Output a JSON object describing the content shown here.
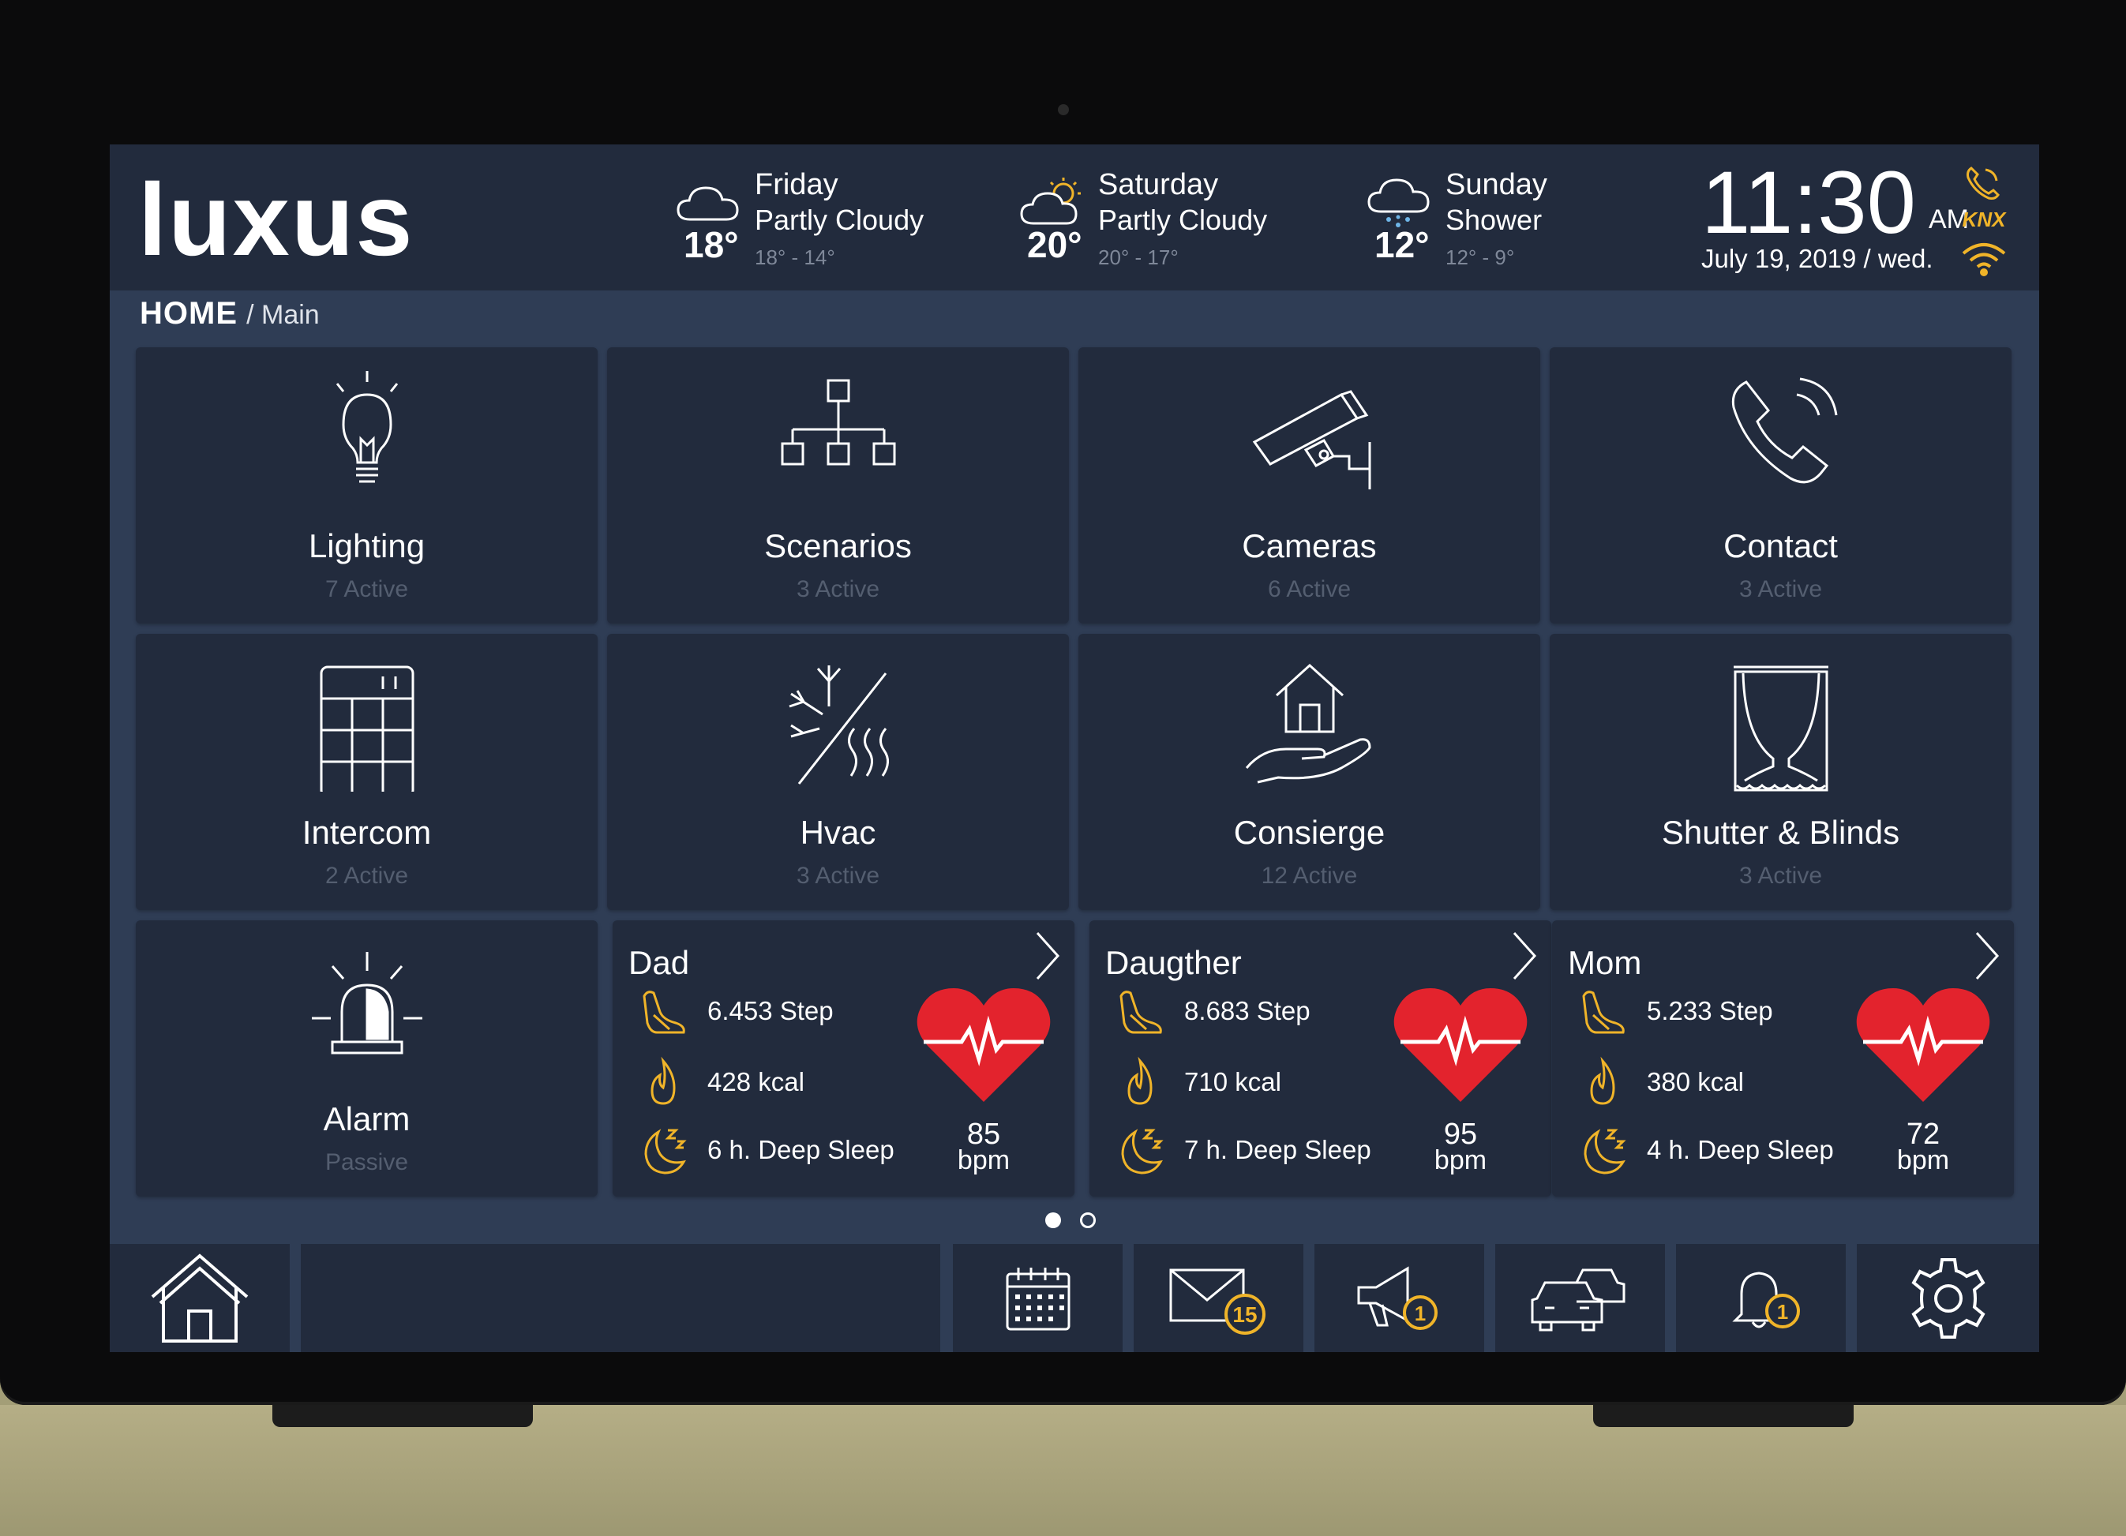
{
  "logo": "luxus",
  "weather": [
    {
      "day": "Friday",
      "condition": "Partly Cloudy",
      "temp": "18°",
      "range": "18° - 14°",
      "icon": "cloud-icon"
    },
    {
      "day": "Saturday",
      "condition": "Partly Cloudy",
      "temp": "20°",
      "range": "20° - 17°",
      "icon": "partly-cloudy-icon"
    },
    {
      "day": "Sunday",
      "condition": "Shower",
      "temp": "12°",
      "range": "12° - 9°",
      "icon": "shower-icon"
    }
  ],
  "clock": {
    "time": "11:30",
    "ampm": "AM",
    "date": "July 19, 2019 / wed."
  },
  "status": {
    "knx": "KNX"
  },
  "breadcrumb": {
    "home": "HOME",
    "sub": "/ Main"
  },
  "tiles": [
    {
      "name": "Lighting",
      "status": "7 Active",
      "icon": "lightbulb-icon"
    },
    {
      "name": "Scenarios",
      "status": "3 Active",
      "icon": "hierarchy-icon"
    },
    {
      "name": "Cameras",
      "status": "6 Active",
      "icon": "security-camera-icon"
    },
    {
      "name": "Contact",
      "status": "3 Active",
      "icon": "phone-icon"
    },
    {
      "name": "Intercom",
      "status": "2 Active",
      "icon": "intercom-icon"
    },
    {
      "name": "Hvac",
      "status": "3 Active",
      "icon": "hvac-icon"
    },
    {
      "name": "Consierge",
      "status": "12 Active",
      "icon": "house-hand-icon"
    },
    {
      "name": "Shutter & Blinds",
      "status": "3 Active",
      "icon": "curtains-icon"
    },
    {
      "name": "Alarm",
      "status": "Passive",
      "icon": "alarm-siren-icon"
    }
  ],
  "health": [
    {
      "name": "Dad",
      "steps": "6.453 Step",
      "kcal": "428 kcal",
      "sleep": "6 h. Deep Sleep",
      "bpm": "85",
      "bpm_unit": "bpm"
    },
    {
      "name": "Daugther",
      "steps": "8.683 Step",
      "kcal": "710 kcal",
      "sleep": "7 h. Deep Sleep",
      "bpm": "95",
      "bpm_unit": "bpm"
    },
    {
      "name": "Mom",
      "steps": "5.233 Step",
      "kcal": "380 kcal",
      "sleep": "4 h. Deep Sleep",
      "bpm": "72",
      "bpm_unit": "bpm"
    }
  ],
  "pager": {
    "pages": 2,
    "current": 1
  },
  "bottom_bar": {
    "mail_badge": "15",
    "announce_badge": "1",
    "notify_badge": "1"
  },
  "colors": {
    "accent": "#f0b429",
    "heart": "#e3232d",
    "tile_bg": "#222b3d",
    "screen_bg": "#2f3d55"
  }
}
